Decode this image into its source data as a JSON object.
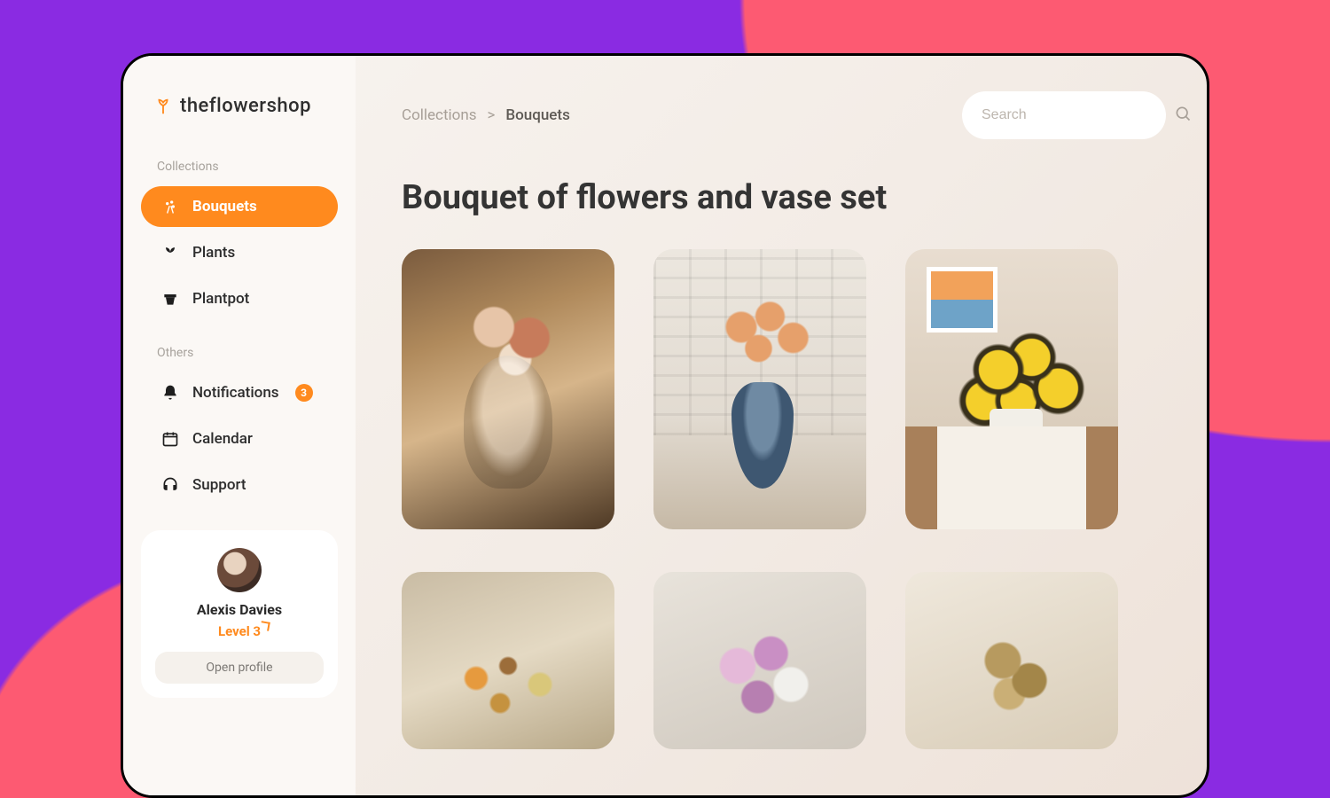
{
  "brand": {
    "name": "theflowershop"
  },
  "sidebar": {
    "section_collections": "Collections",
    "section_others": "Others",
    "items": {
      "bouquets": {
        "label": "Bouquets",
        "icon": "bouquet-icon"
      },
      "plants": {
        "label": "Plants",
        "icon": "plant-icon"
      },
      "plantpot": {
        "label": "Plantpot",
        "icon": "pot-icon"
      },
      "notifications": {
        "label": "Notifications",
        "icon": "bell-icon",
        "badge": "3"
      },
      "calendar": {
        "label": "Calendar",
        "icon": "calendar-icon"
      },
      "support": {
        "label": "Support",
        "icon": "headset-icon"
      }
    }
  },
  "profile": {
    "name": "Alexis Davies",
    "level": "Level 3",
    "open_label": "Open profile"
  },
  "breadcrumb": {
    "root": "Collections",
    "sep": ">",
    "current": "Bouquets"
  },
  "search": {
    "placeholder": "Search"
  },
  "page": {
    "title": "Bouquet of flowers and vase set"
  },
  "products": [
    {
      "name": "roses-glass-vase"
    },
    {
      "name": "orange-flowers-blue-pitcher"
    },
    {
      "name": "sunflowers-ceramic-vase"
    },
    {
      "name": "dried-wildflowers"
    },
    {
      "name": "pink-bouquet"
    },
    {
      "name": "dried-gold-bouquet"
    }
  ],
  "colors": {
    "accent": "#ff8a1e",
    "bg_purple": "#8a2be2",
    "bg_pink": "#fd5a72"
  }
}
